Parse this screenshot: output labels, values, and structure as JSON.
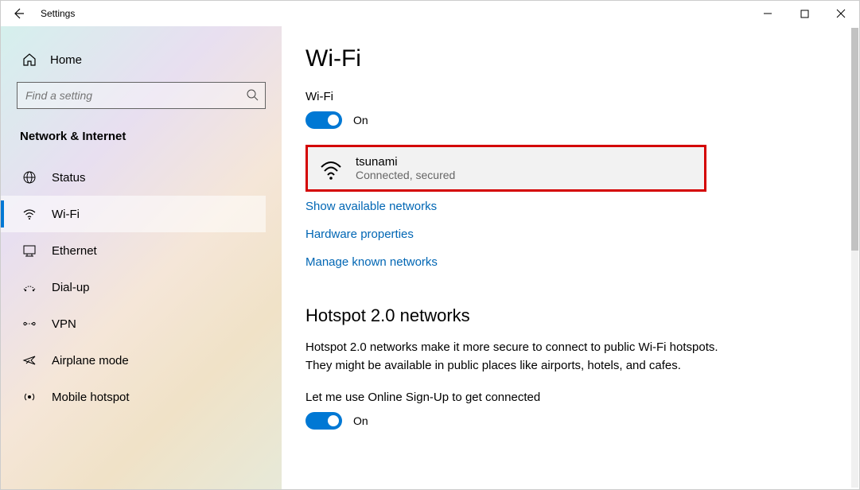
{
  "window": {
    "title": "Settings"
  },
  "sidebar": {
    "home": "Home",
    "search_placeholder": "Find a setting",
    "category": "Network & Internet",
    "items": [
      {
        "label": "Status"
      },
      {
        "label": "Wi-Fi"
      },
      {
        "label": "Ethernet"
      },
      {
        "label": "Dial-up"
      },
      {
        "label": "VPN"
      },
      {
        "label": "Airplane mode"
      },
      {
        "label": "Mobile hotspot"
      }
    ]
  },
  "main": {
    "title": "Wi-Fi",
    "wifi_label": "Wi-Fi",
    "wifi_toggle": "On",
    "network": {
      "name": "tsunami",
      "status": "Connected, secured"
    },
    "links": {
      "show": "Show available networks",
      "hardware": "Hardware properties",
      "manage": "Manage known networks"
    },
    "hotspot": {
      "title": "Hotspot 2.0 networks",
      "desc": "Hotspot 2.0 networks make it more secure to connect to public Wi-Fi hotspots. They might be available in public places like airports, hotels, and cafes.",
      "signup_label": "Let me use Online Sign-Up to get connected",
      "signup_toggle": "On"
    }
  }
}
